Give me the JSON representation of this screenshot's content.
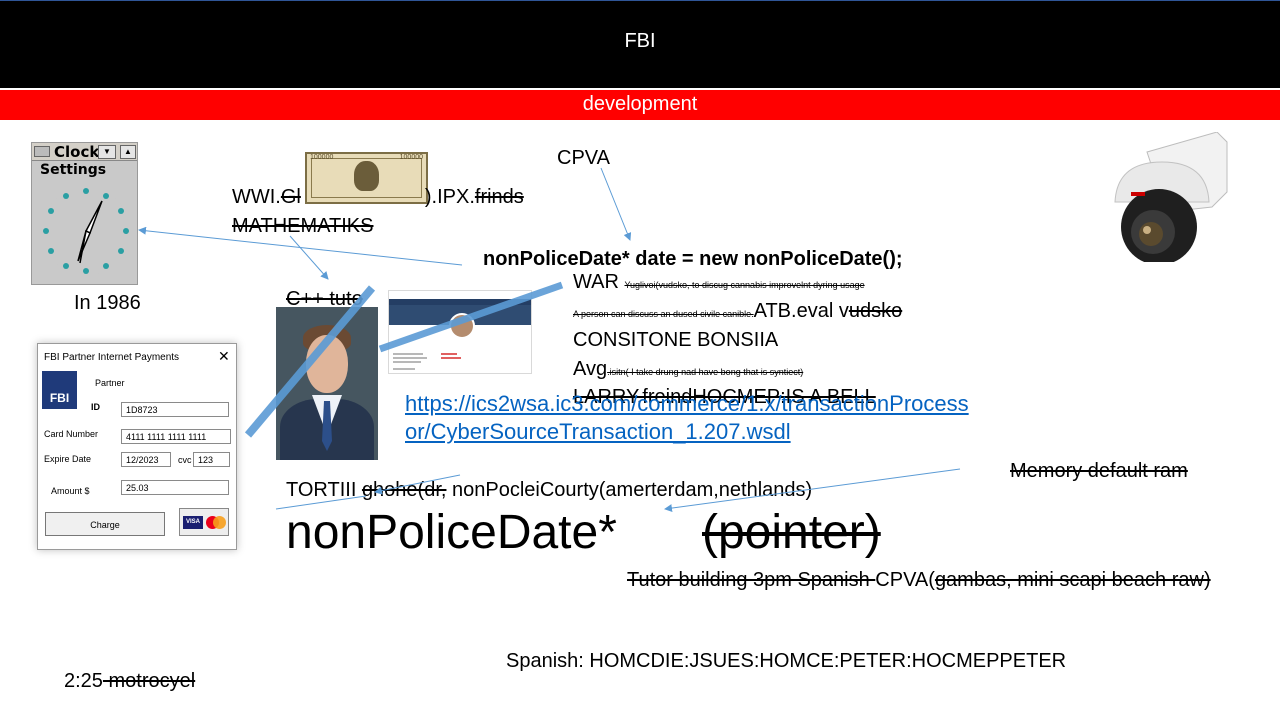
{
  "header": {
    "title": "FBI",
    "subtitle": "development"
  },
  "clock_widget": {
    "title": "Clock",
    "settings_label": "Settings",
    "caption": "In 1986"
  },
  "payment_dialog": {
    "title": "FBI Partner Internet Payments",
    "close_glyph": "✕",
    "logo_text": "FBI",
    "partner_label": "Partner",
    "id_label": "ID",
    "id_value": "1D8723",
    "card_label": "Card Number",
    "card_value": "4111 1111 1111 1111",
    "expire_label": "Expire Date",
    "expire_value": "12/2023",
    "cvc_label": "cvc",
    "cvc_value": "123",
    "amount_label": "Amount $",
    "amount_value": "25.03",
    "charge_button": "Charge",
    "visa_text": "VISA"
  },
  "banknote": {
    "denomination": "100000"
  },
  "texts": {
    "wwi_prefix": "WWI.",
    "wwi_struck": "Gl",
    "wwi_mid": ").IPX.",
    "wwi_struck2": "frinds",
    "mathematiks": "MATHEMATIKS",
    "cpp_tuto": "C++ tuto",
    "cpva": "CPVA",
    "code_line": "nonPoliceDate* date = new nonPoliceDate();",
    "war": "WAR",
    "war_small": "Yuglivoi(vudsko, to discug cannabis improvelnt dyring usage",
    "person_small": "A person can discuss an dused civile canible.",
    "atb_eval": "ATB.eval v",
    "atb_struck": "udsko",
    "consitone": "CONSITONE BONSIIA",
    "avg": "Avg",
    "avg_small": ".isitn( I take drung nad have bong that is syntiect)",
    "larry": "LARRY.freindHOCMEP:IS A BELL",
    "url_line1": "https://ics2wsa.ic3.com/commerce/1.x/transactionProcess",
    "url_line2": "or/CyberSourceTransaction_1.207.wsdl",
    "memory": "Memory default ram",
    "tortiii": "TORTIII ",
    "tortiii_struck": "ghohe(dr,",
    "tortiii_rest": " nonPocleiCourty(amerterdam,nethlands)",
    "big_ptr": "nonPoliceDate*",
    "big_struck": "(pointer)",
    "tutor_struck": "Tutor building 3pm Spanish ",
    "tutor_cpva": "CPVA(",
    "tutor_struck2": "gambas, mini scapi beach raw)",
    "spanish": "Spanish: HOMCDIE:JSUES:HOMCE:PETER:HOCMEPPETER",
    "time": "2:25",
    "time_struck": " motrocyel"
  },
  "colors": {
    "accent_red": "#ff0000",
    "arrow_blue": "#5b9bd5",
    "link_blue": "#0563c1"
  }
}
